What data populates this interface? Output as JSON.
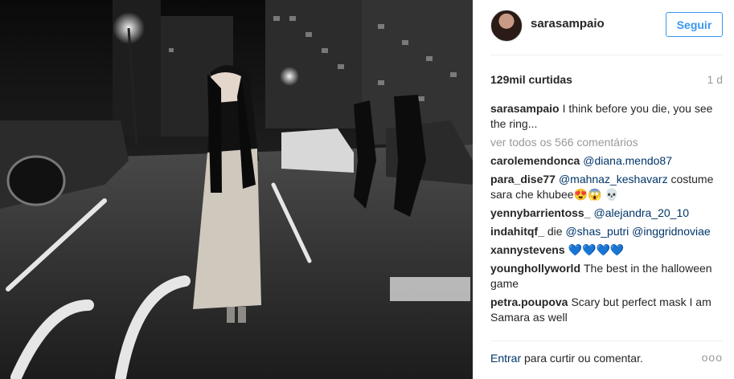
{
  "post": {
    "username": "sarasampaio",
    "follow_label": "Seguir",
    "likes": "129mil curtidas",
    "time": "1 d",
    "caption": "I think before you die, you see the ring...",
    "view_all": "ver todos os 566 comentários",
    "login_link": "Entrar",
    "login_rest": " para curtir ou comentar.",
    "more_label": "ooo"
  },
  "comments": [
    {
      "user": "carolemendonca",
      "parts": [
        {
          "t": "@diana.mendo87",
          "m": true
        }
      ]
    },
    {
      "user": "para_dise77",
      "parts": [
        {
          "t": "@mahnaz_keshavarz",
          "m": true
        },
        {
          "t": " costume sara che khubee😍😱 💀",
          "m": false
        }
      ]
    },
    {
      "user": "yennybarrientoss_",
      "parts": [
        {
          "t": "@alejandra_20_10",
          "m": true
        }
      ]
    },
    {
      "user": "indahitqf_",
      "parts": [
        {
          "t": "die ",
          "m": false
        },
        {
          "t": "@shas_putri",
          "m": true
        },
        {
          "t": " ",
          "m": false
        },
        {
          "t": "@inggridnoviae",
          "m": true
        }
      ]
    },
    {
      "user": "xannystevens",
      "parts": [
        {
          "t": "💙💙💙💙",
          "m": false
        }
      ]
    },
    {
      "user": "younghollyworld",
      "parts": [
        {
          "t": "The best in the halloween game",
          "m": false
        }
      ]
    },
    {
      "user": "petra.poupova",
      "parts": [
        {
          "t": "Scary but perfect mask I am Samara as well",
          "m": false
        }
      ]
    }
  ]
}
